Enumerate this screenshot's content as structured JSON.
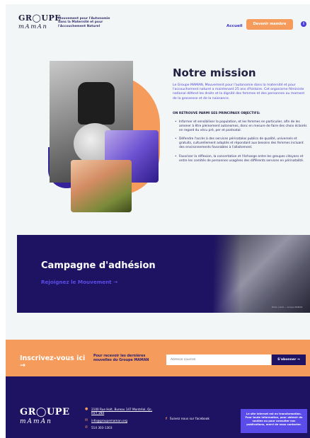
{
  "header": {
    "logo_line1": "GR◯UPE",
    "logo_line2": "mAmAn",
    "tagline": "Mouvement pour l'Autonomie dans la Maternité et pour l'Accouchement Naturel",
    "nav_home": "Accueil",
    "member_button": "Devenir membre"
  },
  "mission": {
    "title": "Notre mission",
    "description": "Le Groupe MAMAN, Mouvement pour l'autonomie dans la maternité et pour l'accouchement naturel a maintenant 25 ans d'histoire. Cet organisme féministe national défend les droits et la dignité des femmes et des personnes au moment de la grossesse et de la naissance.",
    "objectives_title": "ON RETROUVE PARMI SES PRINCIPAUX OBJECTIFS:",
    "objectives": [
      "Informer et sensibiliser la population, et les femmes en particulier, afin de les amener à être pleinement autonomes, donc en mesure de faire des choix éclairés en regard du vécu pré, per et postnatal.",
      "Défendre l'accès à des services périnatalos publics de qualité, universels et gratuits, culturellement adaptés et répondant aux besoins des femmes incluant des environnements favorables à l'allaitement.",
      "Favoriser la réflexion, la concertation et l'échange entre les groupes citoyens et entre les comités de personnes usagères des différents services en périnatalité."
    ]
  },
  "campaign": {
    "title": "Campagne d'adhésion",
    "link": "Rejoignez le Mouvement →",
    "caption": "Photo crédit — Groupe MAMAN"
  },
  "newsletter": {
    "title": "Inscrivez-vous ici →",
    "description": "Pour recevoir les dernières nouvelles du Groupe MAMAN",
    "input_placeholder": "Adresse courriel",
    "button": "S'abonner →"
  },
  "footer": {
    "logo_line1": "GR◯UPE",
    "logo_line2": "mAmAn",
    "address": "2100 Rue Holt, Bureau 147 Montréal, Qc, H1Y 1N4",
    "email": "info@groupemaman.org",
    "phone": "514 303-1303",
    "facebook": "Suivez nous sur facebook",
    "notice": "Le site internet est en transformation. Pour toute information, pour obtenir du soutien ou pour consulter nos publications, merci de nous contacter."
  },
  "colors": {
    "navy": "#1e1262",
    "orange": "#f59b5c",
    "violet": "#4a3ed8",
    "background": "#f3f6f7"
  }
}
